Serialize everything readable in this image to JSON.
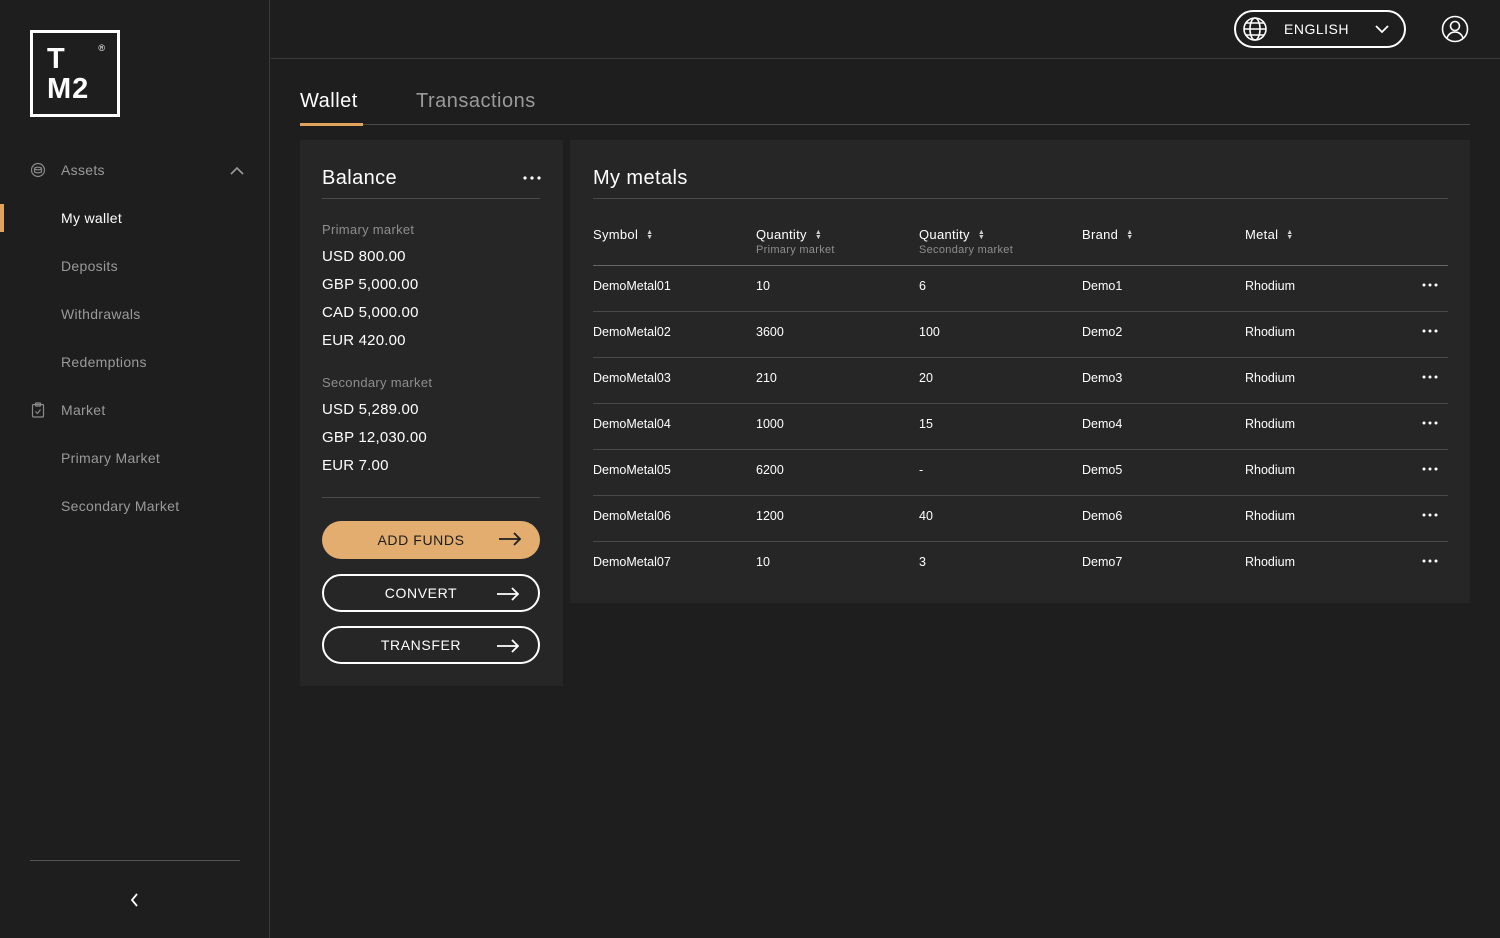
{
  "logo": {
    "line1": "T",
    "line2": "M2",
    "mark": "®"
  },
  "sidebar": {
    "groups": [
      {
        "label": "Assets",
        "icon": "coin-stack-icon",
        "items": [
          "My wallet",
          "Deposits",
          "Withdrawals",
          "Redemptions"
        ]
      },
      {
        "label": "Market",
        "icon": "clipboard-icon",
        "items": [
          "Primary Market",
          "Secondary Market"
        ]
      }
    ],
    "active_item": "My wallet"
  },
  "header": {
    "language": "ENGLISH"
  },
  "tabs": [
    "Wallet",
    "Transactions"
  ],
  "balance": {
    "title": "Balance",
    "primary_label": "Primary market",
    "primary": [
      "USD 800.00",
      "GBP 5,000.00",
      "CAD 5,000.00",
      "EUR 420.00"
    ],
    "secondary_label": "Secondary market",
    "secondary": [
      "USD 5,289.00",
      "GBP 12,030.00",
      "EUR 7.00"
    ],
    "buttons": {
      "add_funds": "ADD FUNDS",
      "convert": "CONVERT",
      "transfer": "TRANSFER"
    }
  },
  "metals": {
    "title": "My metals",
    "columns": [
      {
        "label": "Symbol",
        "sub": ""
      },
      {
        "label": "Quantity",
        "sub": "Primary market"
      },
      {
        "label": "Quantity",
        "sub": "Secondary market"
      },
      {
        "label": "Brand",
        "sub": ""
      },
      {
        "label": "Metal",
        "sub": ""
      }
    ],
    "rows": [
      [
        "DemoMetal01",
        "10",
        "6",
        "Demo1",
        "Rhodium"
      ],
      [
        "DemoMetal02",
        "3600",
        "100",
        "Demo2",
        "Rhodium"
      ],
      [
        "DemoMetal03",
        "210",
        "20",
        "Demo3",
        "Rhodium"
      ],
      [
        "DemoMetal04",
        "1000",
        "15",
        "Demo4",
        "Rhodium"
      ],
      [
        "DemoMetal05",
        "6200",
        "-",
        "Demo5",
        "Rhodium"
      ],
      [
        "DemoMetal06",
        "1200",
        "40",
        "Demo6",
        "Rhodium"
      ],
      [
        "DemoMetal07",
        "10",
        "3",
        "Demo7",
        "Rhodium"
      ]
    ]
  },
  "colors": {
    "accent": "#e0a45e",
    "button": "#e2ad6e",
    "background": "#1e1e1e",
    "card": "#262626"
  }
}
